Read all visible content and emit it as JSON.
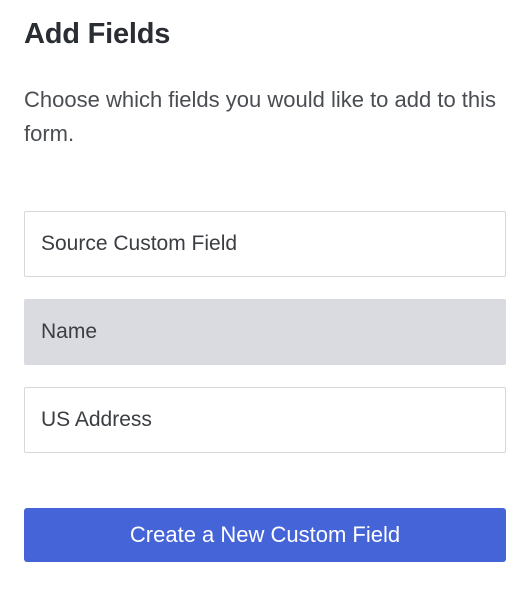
{
  "heading": "Add Fields",
  "description": "Choose which fields you would like to add to this form.",
  "fields": [
    {
      "label": "Source Custom Field",
      "selected": false
    },
    {
      "label": "Name",
      "selected": true
    },
    {
      "label": "US Address",
      "selected": false
    }
  ],
  "create_button": "Create a New Custom Field"
}
